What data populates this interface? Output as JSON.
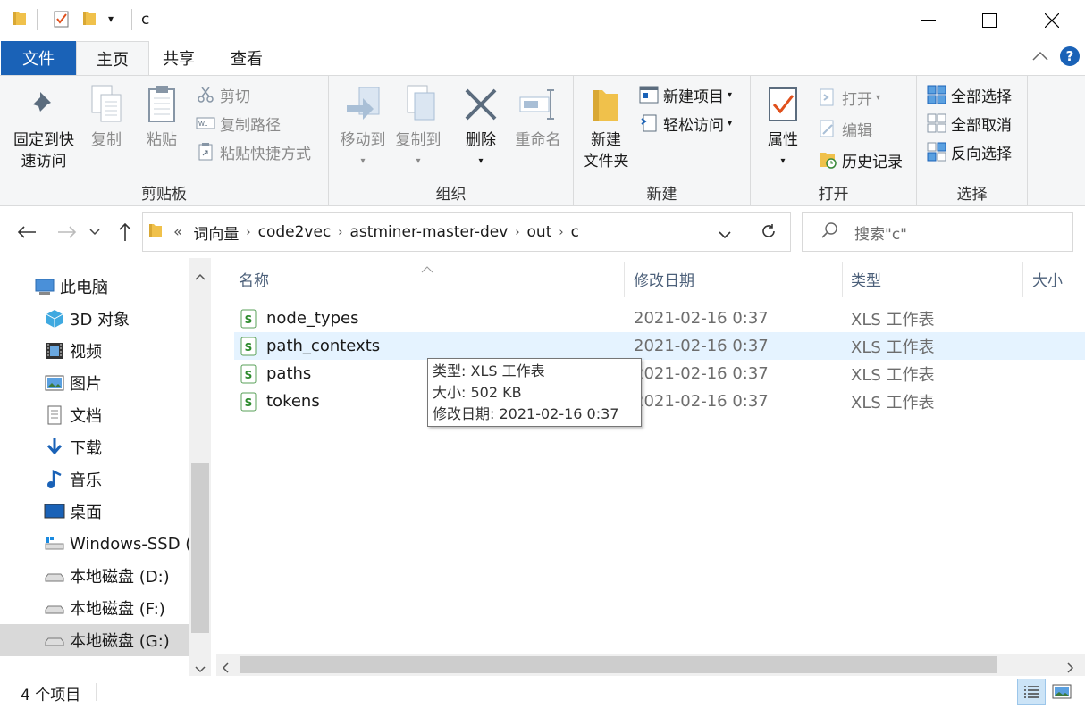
{
  "window": {
    "title": "c"
  },
  "tabs": {
    "file": "文件",
    "home": "主页",
    "share": "共享",
    "view": "查看"
  },
  "ribbon": {
    "clipboard": {
      "label": "剪贴板",
      "pin_line1": "固定到快",
      "pin_line2": "速访问",
      "copy": "复制",
      "paste": "粘贴",
      "cut": "剪切",
      "copy_path": "复制路径",
      "paste_shortcut": "粘贴快捷方式"
    },
    "organize": {
      "label": "组织",
      "move_to": "移动到",
      "copy_to": "复制到",
      "delete": "删除",
      "rename": "重命名"
    },
    "new": {
      "label": "新建",
      "new_folder_line1": "新建",
      "new_folder_line2": "文件夹",
      "new_item": "新建项目",
      "easy_access": "轻松访问"
    },
    "open": {
      "label": "打开",
      "properties": "属性",
      "open": "打开",
      "edit": "编辑",
      "history": "历史记录"
    },
    "select": {
      "label": "选择",
      "select_all": "全部选择",
      "select_none": "全部取消",
      "invert": "反向选择"
    }
  },
  "address": {
    "prefix": "«",
    "crumbs": [
      "词向量",
      "code2vec",
      "astminer-master-dev",
      "out",
      "c"
    ],
    "search_placeholder": "搜索\"c\""
  },
  "nav": {
    "items": [
      {
        "label": "此电脑",
        "icon": "computer-icon"
      },
      {
        "label": "3D 对象",
        "icon": "cube-icon"
      },
      {
        "label": "视频",
        "icon": "video-icon"
      },
      {
        "label": "图片",
        "icon": "pictures-icon"
      },
      {
        "label": "文档",
        "icon": "document-icon"
      },
      {
        "label": "下载",
        "icon": "download-icon"
      },
      {
        "label": "音乐",
        "icon": "music-icon"
      },
      {
        "label": "桌面",
        "icon": "desktop-icon"
      },
      {
        "label": "Windows-SSD (",
        "icon": "windows-drive-icon"
      },
      {
        "label": "本地磁盘 (D:)",
        "icon": "drive-icon"
      },
      {
        "label": "本地磁盘 (F:)",
        "icon": "drive-icon"
      },
      {
        "label": "本地磁盘 (G:)",
        "icon": "drive-icon"
      }
    ]
  },
  "list": {
    "columns": {
      "name": "名称",
      "date": "修改日期",
      "type": "类型",
      "size": "大小"
    },
    "rows": [
      {
        "name": "node_types",
        "date": "2021-02-16 0:37",
        "type": "XLS 工作表"
      },
      {
        "name": "path_contexts",
        "date": "2021-02-16 0:37",
        "type": "XLS 工作表"
      },
      {
        "name": "paths",
        "date": "2021-02-16 0:37",
        "type": "XLS 工作表"
      },
      {
        "name": "tokens",
        "date": "2021-02-16 0:37",
        "type": "XLS 工作表"
      }
    ],
    "tooltip": {
      "type": "类型: XLS 工作表",
      "size": "大小: 502 KB",
      "modified": "修改日期: 2021-02-16 0:37"
    }
  },
  "status": {
    "count": "4 个项目"
  },
  "colors": {
    "accent": "#1a62b7",
    "hover_row": "#e5f3ff",
    "folder": "#f0c14b"
  }
}
